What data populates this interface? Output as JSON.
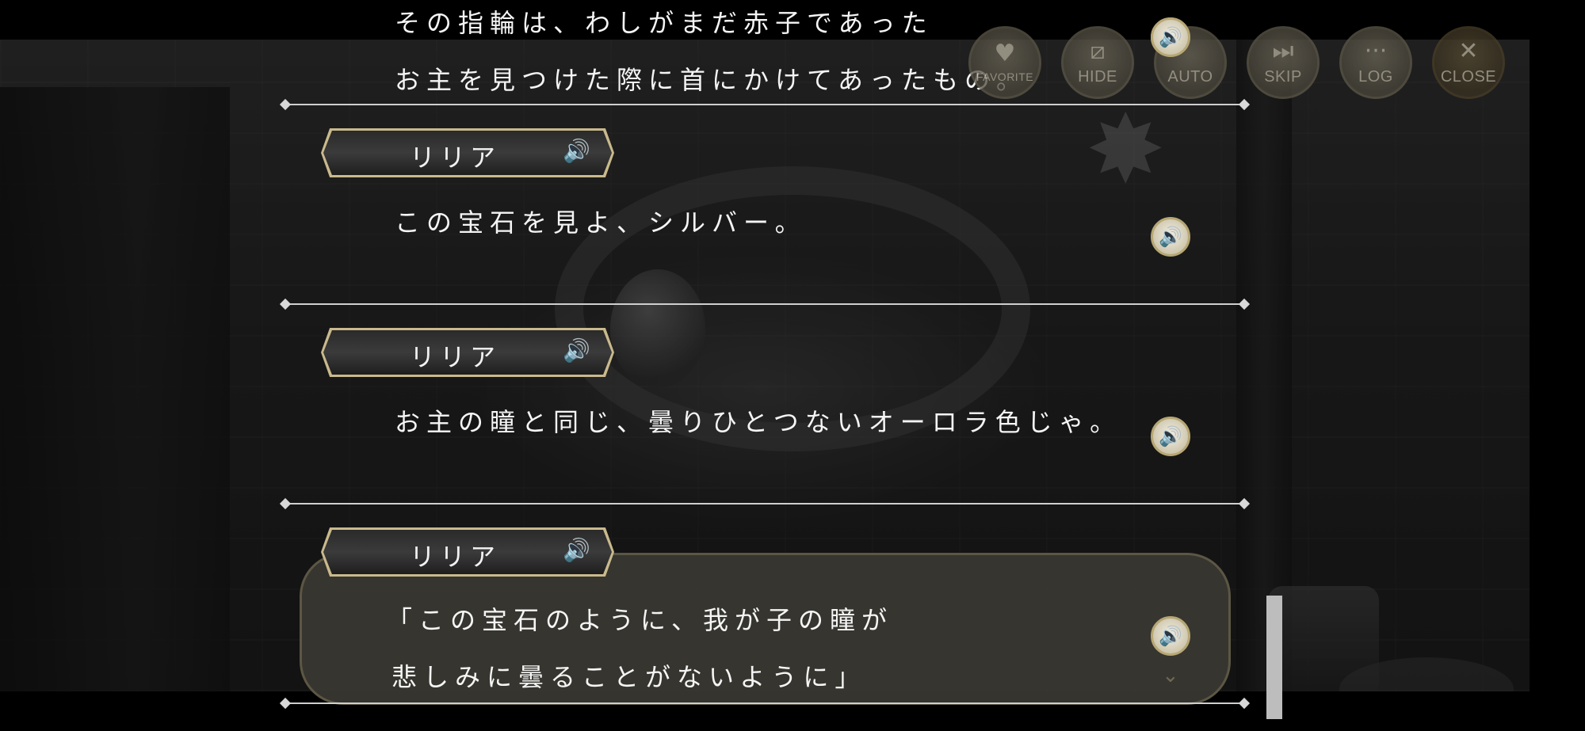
{
  "menu": {
    "favorite": "FAVORITE",
    "hide": "HIDE",
    "auto": "AUTO",
    "skip": "SKIP",
    "log": "LOG",
    "close": "CLOSE"
  },
  "icons": {
    "speaker": "speaker-icon",
    "heart": "heart-icon",
    "hide": "hide-icon",
    "skip": "skip-icon",
    "log": "log-icon",
    "close": "close-icon",
    "chevron": "chevron-down-icon"
  },
  "colors": {
    "accent_gold": "#c9b98c",
    "text": "#f5f5f5",
    "separator": "#cfcfcf"
  },
  "log": {
    "entries": [
      {
        "lines": [
          "その指輪は、わしがまだ赤子であった",
          "お主を見つけた際に首にかけてあったもの。"
        ]
      },
      {
        "speaker": "リリア",
        "lines": [
          "この宝石を見よ、シルバー。"
        ]
      },
      {
        "speaker": "リリア",
        "lines": [
          "お主の瞳と同じ、曇りひとつないオーロラ色じゃ。"
        ]
      },
      {
        "speaker": "リリア",
        "lines": [
          "「この宝石のように、我が子の瞳が",
          "悲しみに曇ることがないように」"
        ]
      }
    ]
  }
}
